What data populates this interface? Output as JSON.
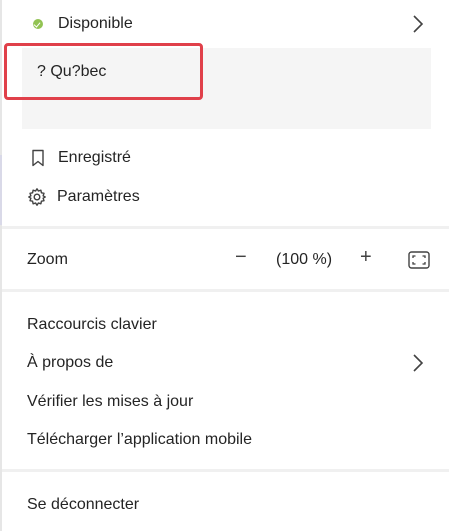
{
  "menu": {
    "status": {
      "label": "Disponible"
    },
    "status_message": "? Qu?bec",
    "saved": "Enregistré",
    "settings": "Paramètres",
    "zoom": {
      "label": "Zoom",
      "minus": "−",
      "value": "(100 %)",
      "plus": "+"
    },
    "keyboard_shortcuts": "Raccourcis clavier",
    "about": "À propos de",
    "check_updates": "Vérifier les mises à jour",
    "download_mobile": "Télécharger l’application mobile",
    "sign_out": "Se déconnecter"
  },
  "colors": {
    "presence_available": "#92c353",
    "highlight_border": "#e0404a",
    "status_background": "#f5f5f5",
    "divider": "#f0f0f0"
  },
  "icons": [
    "check-circle-icon",
    "chevron-right-icon",
    "bookmark-icon",
    "gear-icon",
    "minus-icon",
    "plus-icon",
    "fullscreen-icon"
  ]
}
